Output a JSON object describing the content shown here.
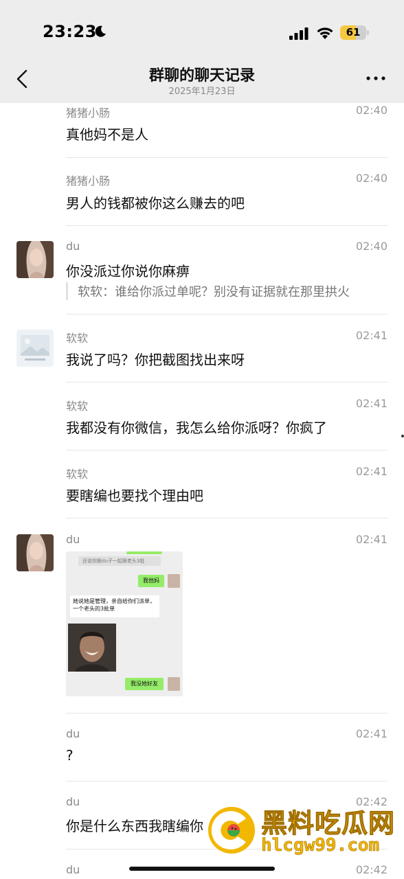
{
  "status_bar": {
    "time": "23:23",
    "battery": "61",
    "battery_level": 0.61
  },
  "header": {
    "title": "群聊的聊天记录",
    "date": "2025年1月23日"
  },
  "messages": [
    {
      "sender": "猪猪小肠",
      "time": "02:40",
      "text": "真他妈不是人"
    },
    {
      "sender": "猪猪小肠",
      "time": "02:40",
      "text": "男人的钱都被你这么赚去的吧"
    },
    {
      "sender": "du",
      "time": "02:40",
      "text": "你没派过你说你麻痹",
      "quote": "软软：谁给你派过单呢？别没有证据就在那里拱火"
    },
    {
      "sender": "软软",
      "time": "02:41",
      "text": "我说了吗？你把截图找出来呀"
    },
    {
      "sender": "软软",
      "time": "02:41",
      "text": "我都没有你微信，我怎么给你派呀？你疯了"
    },
    {
      "sender": "软软",
      "time": "02:41",
      "text": "要瞎编也要找个理由吧"
    },
    {
      "sender": "du",
      "time": "02:41"
    },
    {
      "sender": "du",
      "time": "02:41",
      "text": "?"
    },
    {
      "sender": "du",
      "time": "02:42",
      "text": "你是什么东西我瞎编你"
    },
    {
      "sender": "du",
      "time": "02:42"
    }
  ],
  "image_message": {
    "top_line": "还说你跟du子一起跟老头3批",
    "bubble1": "我他妈",
    "bubble2": "她说她是管理，亲自给你们派单，一个老头的3批单",
    "bubble3": "我没她好友"
  },
  "watermark": {
    "name": "黑料吃瓜网",
    "url": "hlcgw99.com"
  },
  "colors": {
    "bg": "#ffffff",
    "header_bg": "#ededed",
    "wechat_green": "#95ec69",
    "battery": "#f5c842",
    "watermark": "#f2b700"
  }
}
